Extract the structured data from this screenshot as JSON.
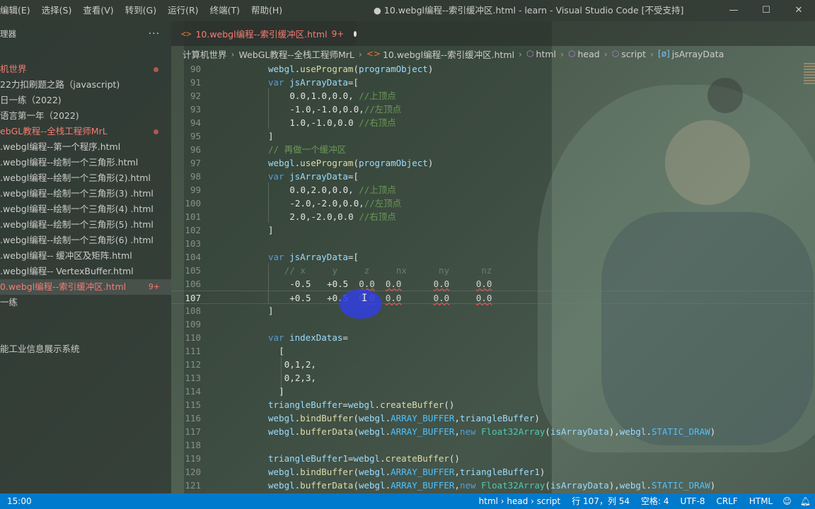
{
  "window": {
    "title": "● 10.webgl编程--索引缓冲区.html - learn - Visual Studio Code [不受支持]",
    "controls": [
      "—",
      "☐",
      "✕"
    ]
  },
  "menu": [
    "编辑(E)",
    "选择(S)",
    "查看(V)",
    "转到(G)",
    "运行(R)",
    "终端(T)",
    "帮助(H)"
  ],
  "sidebar": {
    "title": "理器",
    "more": "···",
    "items": [
      {
        "label": "机世界",
        "red": true,
        "dot": true
      },
      {
        "label": "22力扣刷题之路（javascript)",
        "red": false
      },
      {
        "label": "日一练（2022)",
        "red": false
      },
      {
        "label": "语言第一年（2022)",
        "red": false
      },
      {
        "label": "ebGL教程--全栈工程师MrL",
        "red": true,
        "dot": true
      },
      {
        "label": ".webgl编程--第一个程序.html",
        "red": false
      },
      {
        "label": ".webgl编程--绘制一个三角形.html",
        "red": false
      },
      {
        "label": ".webgl编程--绘制一个三角形(2).html",
        "red": false
      },
      {
        "label": ".webgl编程--绘制一个三角形(3) .html",
        "red": false
      },
      {
        "label": ".webgl编程--绘制一个三角形(4) .html",
        "red": false
      },
      {
        "label": ".webgl编程--绘制一个三角形(5) .html",
        "red": false
      },
      {
        "label": ".webgl编程--绘制一个三角形(6) .html",
        "red": false
      },
      {
        "label": ".webgl编程-- 缓冲区及矩阵.html",
        "red": false
      },
      {
        "label": ".webgl编程-- VertexBuffer.html",
        "red": false
      },
      {
        "label": "0.webgl编程--索引缓冲区.html",
        "red": true,
        "active": true,
        "badge": "9+"
      },
      {
        "label": "一练",
        "red": false
      },
      {
        "label": "",
        "red": false
      },
      {
        "label": "",
        "red": false
      },
      {
        "label": "能工业信息展示系统",
        "red": false
      }
    ]
  },
  "tab": {
    "icon": "<>",
    "label": "10.webgl编程--索引缓冲区.html",
    "count": "9+"
  },
  "breadcrumb": {
    "items": [
      "计算机世界",
      "WebGL教程--全栈工程师MrL",
      "10.webgl编程--索引缓冲区.html",
      "html",
      "head",
      "script",
      "jsArrayData"
    ]
  },
  "editor": {
    "current_line": 107,
    "lines": [
      {
        "n": "90",
        "ind": 0,
        "t": [
          [
            "webgl",
            "var"
          ],
          [
            ".",
            "pl"
          ],
          [
            "useProgram",
            "fn"
          ],
          [
            "(",
            "pl"
          ],
          [
            "programObject",
            "var"
          ],
          [
            ")",
            "pl"
          ]
        ]
      },
      {
        "n": "91",
        "ind": 0,
        "t": [
          [
            "var ",
            "kw"
          ],
          [
            "jsArrayData",
            "var"
          ],
          [
            "=[",
            "pl"
          ]
        ]
      },
      {
        "n": "92",
        "ind": 4,
        "t": [
          [
            "0.0,1.0,0.0, ",
            "pl"
          ],
          [
            "//上顶点",
            "cm"
          ]
        ]
      },
      {
        "n": "93",
        "ind": 4,
        "t": [
          [
            "-1.0,-1.0,0.0,",
            "pl"
          ],
          [
            "//左顶点",
            "cm"
          ]
        ]
      },
      {
        "n": "94",
        "ind": 4,
        "t": [
          [
            "1.0,-1.0,0.0 ",
            "pl"
          ],
          [
            "//右顶点",
            "cm"
          ]
        ]
      },
      {
        "n": "95",
        "ind": 0,
        "t": [
          [
            "]",
            "pl"
          ]
        ]
      },
      {
        "n": "96",
        "ind": 0,
        "t": [
          [
            "// 再做一个缓冲区",
            "cm"
          ]
        ]
      },
      {
        "n": "97",
        "ind": 0,
        "t": [
          [
            "webgl",
            "var"
          ],
          [
            ".",
            "pl"
          ],
          [
            "useProgram",
            "fn"
          ],
          [
            "(",
            "pl"
          ],
          [
            "programObject",
            "var"
          ],
          [
            ")",
            "pl"
          ]
        ]
      },
      {
        "n": "98",
        "ind": 0,
        "t": [
          [
            "var ",
            "kw"
          ],
          [
            "jsArrayData",
            "var"
          ],
          [
            "=[",
            "pl"
          ]
        ]
      },
      {
        "n": "99",
        "ind": 4,
        "t": [
          [
            "0.0,2.0,0.0, ",
            "pl"
          ],
          [
            "//上顶点",
            "cm"
          ]
        ]
      },
      {
        "n": "100",
        "ind": 4,
        "t": [
          [
            "-2.0,-2.0,0.0,",
            "pl"
          ],
          [
            "//左顶点",
            "cm"
          ]
        ]
      },
      {
        "n": "101",
        "ind": 4,
        "t": [
          [
            "2.0,-2.0,0.0 ",
            "pl"
          ],
          [
            "//右顶点",
            "cm"
          ]
        ]
      },
      {
        "n": "102",
        "ind": 0,
        "t": [
          [
            "]",
            "pl"
          ]
        ]
      },
      {
        "n": "103",
        "ind": 0,
        "t": []
      },
      {
        "n": "104",
        "ind": 0,
        "t": [
          [
            "var ",
            "kw"
          ],
          [
            "jsArrayData",
            "var"
          ],
          [
            "=[",
            "pl"
          ]
        ]
      },
      {
        "n": "105",
        "ind": 3,
        "t": [
          [
            "// x     y     z     nx      ny      nz",
            "cmd"
          ]
        ]
      },
      {
        "n": "106",
        "ind": 4,
        "t": [
          [
            "-0.5   +0.5  ",
            "pl"
          ],
          [
            "0.0",
            "sq"
          ],
          [
            "  ",
            "pl"
          ],
          [
            "0.0",
            "sq"
          ],
          [
            "      ",
            "pl"
          ],
          [
            "0.0",
            "sq"
          ],
          [
            "     ",
            "pl"
          ],
          [
            "0.0",
            "sq"
          ]
        ]
      },
      {
        "n": "107",
        "ind": 4,
        "t": [
          [
            "+0.5   +0.5  ",
            "pl"
          ],
          [
            "0.0",
            "sq"
          ],
          [
            "  ",
            "pl"
          ],
          [
            "0.0",
            "sq"
          ],
          [
            "      ",
            "pl"
          ],
          [
            "0.0",
            "sq"
          ],
          [
            "     ",
            "pl"
          ],
          [
            "0.0",
            "sq"
          ]
        ]
      },
      {
        "n": "108",
        "ind": 0,
        "t": [
          [
            "]",
            "pl"
          ]
        ]
      },
      {
        "n": "109",
        "ind": 0,
        "t": []
      },
      {
        "n": "110",
        "ind": 0,
        "t": [
          [
            "var ",
            "kw"
          ],
          [
            "indexDatas",
            "var"
          ],
          [
            "=",
            "pl"
          ]
        ]
      },
      {
        "n": "111",
        "ind": 2,
        "t": [
          [
            "[",
            "pl"
          ]
        ]
      },
      {
        "n": "112",
        "ind": 3,
        "t": [
          [
            "0,1,2,",
            "pl"
          ]
        ]
      },
      {
        "n": "113",
        "ind": 3,
        "t": [
          [
            "0,2,3,",
            "pl"
          ]
        ]
      },
      {
        "n": "114",
        "ind": 2,
        "t": [
          [
            "]",
            "pl"
          ]
        ]
      },
      {
        "n": "115",
        "ind": 0,
        "t": [
          [
            "triangleBuffer",
            "var"
          ],
          [
            "=",
            "pl"
          ],
          [
            "webgl",
            "var"
          ],
          [
            ".",
            "pl"
          ],
          [
            "createBuffer",
            "fn"
          ],
          [
            "()",
            "pl"
          ]
        ]
      },
      {
        "n": "116",
        "ind": 0,
        "t": [
          [
            "webgl",
            "var"
          ],
          [
            ".",
            "pl"
          ],
          [
            "bindBuffer",
            "fn"
          ],
          [
            "(",
            "pl"
          ],
          [
            "webgl",
            "var"
          ],
          [
            ".",
            "pl"
          ],
          [
            "ARRAY_BUFFER",
            "cn"
          ],
          [
            ",",
            "pl"
          ],
          [
            "triangleBuffer",
            "var"
          ],
          [
            ")",
            "pl"
          ]
        ]
      },
      {
        "n": "117",
        "ind": 0,
        "t": [
          [
            "webgl",
            "var"
          ],
          [
            ".",
            "pl"
          ],
          [
            "bufferData",
            "fn"
          ],
          [
            "(",
            "pl"
          ],
          [
            "webgl",
            "var"
          ],
          [
            ".",
            "pl"
          ],
          [
            "ARRAY_BUFFER",
            "cn"
          ],
          [
            ",",
            "pl"
          ],
          [
            "new ",
            "kw"
          ],
          [
            "Float32Array",
            "ty"
          ],
          [
            "(",
            "pl"
          ],
          [
            "isArrayData",
            "var"
          ],
          [
            "),",
            "pl"
          ],
          [
            "webgl",
            "var"
          ],
          [
            ".",
            "pl"
          ],
          [
            "STATIC_DRAW",
            "cn"
          ],
          [
            ")",
            "pl"
          ]
        ]
      },
      {
        "n": "118",
        "ind": 0,
        "t": []
      },
      {
        "n": "119",
        "ind": 0,
        "t": [
          [
            "triangleBuffer1",
            "var"
          ],
          [
            "=",
            "pl"
          ],
          [
            "webgl",
            "var"
          ],
          [
            ".",
            "pl"
          ],
          [
            "createBuffer",
            "fn"
          ],
          [
            "()",
            "pl"
          ]
        ]
      },
      {
        "n": "120",
        "ind": 0,
        "t": [
          [
            "webgl",
            "var"
          ],
          [
            ".",
            "pl"
          ],
          [
            "bindBuffer",
            "fn"
          ],
          [
            "(",
            "pl"
          ],
          [
            "webgl",
            "var"
          ],
          [
            ".",
            "pl"
          ],
          [
            "ARRAY_BUFFER",
            "cn"
          ],
          [
            ",",
            "pl"
          ],
          [
            "triangleBuffer1",
            "var"
          ],
          [
            ")",
            "pl"
          ]
        ]
      },
      {
        "n": "121",
        "ind": 0,
        "t": [
          [
            "webgl",
            "var"
          ],
          [
            ".",
            "pl"
          ],
          [
            "bufferData",
            "fn"
          ],
          [
            "(",
            "pl"
          ],
          [
            "webgl",
            "var"
          ],
          [
            ".",
            "pl"
          ],
          [
            "ARRAY_BUFFER",
            "cn"
          ],
          [
            ",",
            "pl"
          ],
          [
            "new ",
            "kw"
          ],
          [
            "Float32Array",
            "ty"
          ],
          [
            "(",
            "pl"
          ],
          [
            "isArrayData",
            "var"
          ],
          [
            "),",
            "pl"
          ],
          [
            "webgl",
            "var"
          ],
          [
            ".",
            "pl"
          ],
          [
            "STATIC_DRAW",
            "cn"
          ],
          [
            ")",
            "pl"
          ]
        ]
      }
    ]
  },
  "statusbar": {
    "time": "15:00",
    "scope": "html › head › script",
    "position": "行 107，列 54",
    "indent": "空格: 4",
    "encoding": "UTF-8",
    "eol": "CRLF",
    "language": "HTML",
    "icons": [
      "feedback-icon",
      "bell-icon"
    ]
  },
  "colors": {
    "statusbar": "#007acc",
    "error_red": "#f47c72",
    "keyword": "#569cd6",
    "comment": "#6a9955"
  }
}
